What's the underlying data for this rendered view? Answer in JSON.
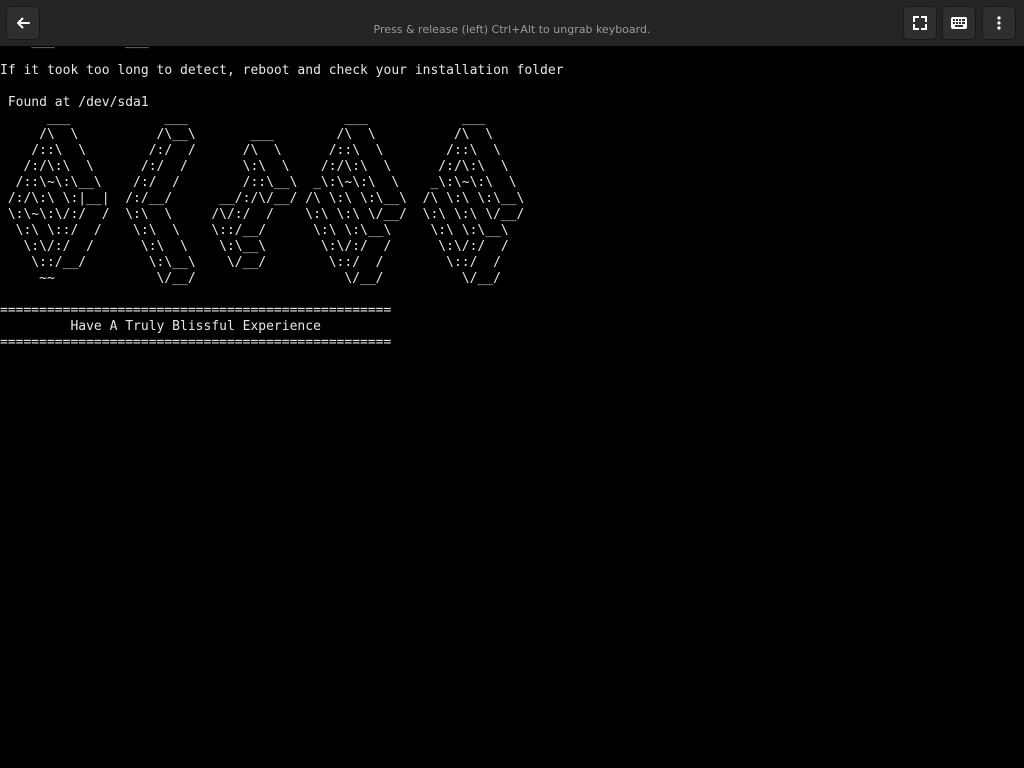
{
  "topbar": {
    "back_icon": "arrow-left-icon",
    "hint": "Press & release (left) Ctrl+Alt to ungrab keyboard.",
    "fullscreen_icon": "fullscreen-icon",
    "keyboard_icon": "keyboard-icon",
    "menu_icon": "kebab-menu-icon"
  },
  "console": {
    "line_partial": "  ~ ___  ~~~~~  ___  ~ ",
    "line_detect": "If it took too long to detect, reboot and check your installation folder",
    "line_found": " Found at /dev/sda1",
    "logo": [
      "      ___            ___                    ___            ___",
      "     /\\  \\          /\\__\\       ___        /\\  \\          /\\  \\",
      "    /::\\  \\        /:/  /      /\\  \\      /::\\  \\        /::\\  \\",
      "   /:/\\:\\  \\      /:/  /       \\:\\  \\    /:/\\:\\  \\      /:/\\:\\  \\",
      "  /::\\~\\:\\__\\    /:/  /        /::\\__\\  _\\:\\~\\:\\  \\    _\\:\\~\\:\\  \\",
      " /:/\\:\\ \\:|__|  /:/__/      __/:/\\/__/ /\\ \\:\\ \\:\\__\\  /\\ \\:\\ \\:\\__\\",
      " \\:\\~\\:\\/:/  /  \\:\\  \\     /\\/:/  /    \\:\\ \\:\\ \\/__/  \\:\\ \\:\\ \\/__/",
      "  \\:\\ \\::/  /    \\:\\  \\    \\::/__/      \\:\\ \\:\\__\\     \\:\\ \\:\\__\\",
      "   \\:\\/:/  /      \\:\\  \\    \\:\\__\\       \\:\\/:/  /      \\:\\/:/  /",
      "    \\::/__/        \\:\\__\\    \\/__/        \\::/  /        \\::/  /",
      "     ~~             \\/__/                   \\/__/          \\/__/"
    ],
    "separator_top": "==================================================",
    "message": "         Have A Truly Blissful Experience",
    "separator_bottom": "=================================================="
  }
}
